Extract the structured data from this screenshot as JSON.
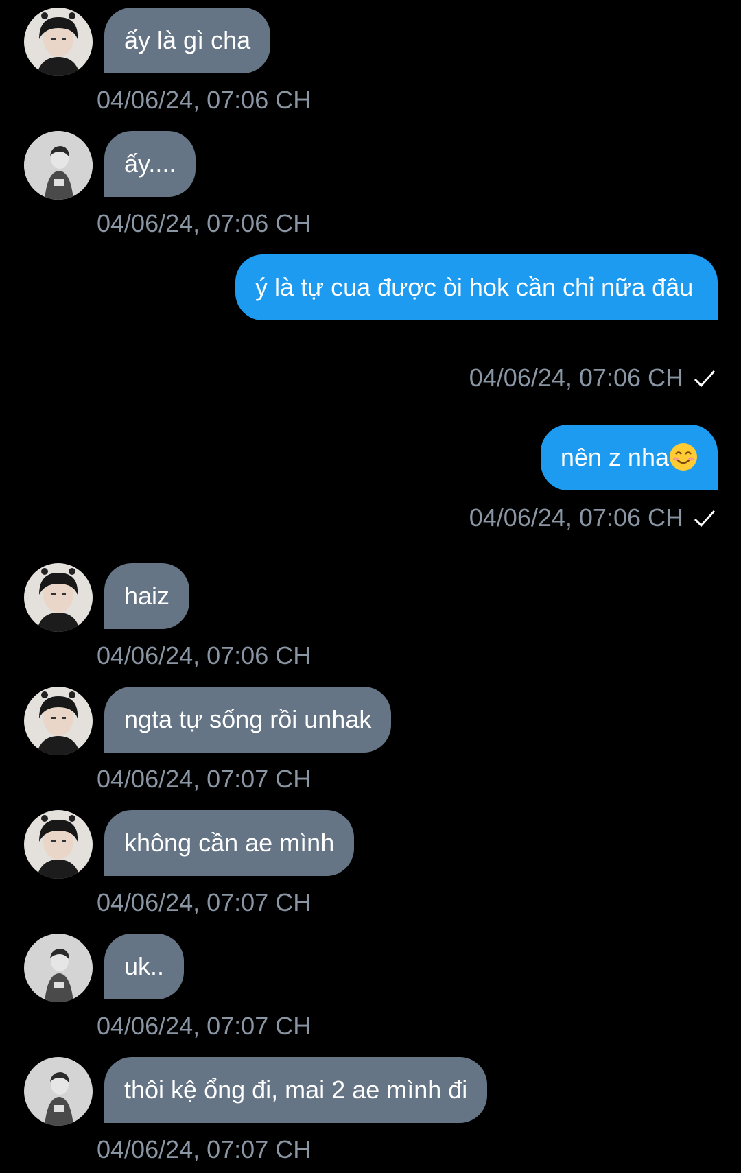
{
  "messages": [
    {
      "side": "in",
      "avatar": "avatar-a",
      "text": "ấy là gì cha",
      "time": "04/06/24, 07:06 CH"
    },
    {
      "side": "in",
      "avatar": "avatar-b",
      "text": "ấy....",
      "time": "04/06/24, 07:06 CH"
    },
    {
      "side": "out",
      "text": "ý là tự cua được òi hok cần chỉ nữa đâu",
      "time": "04/06/24, 07:06 CH",
      "status_icon": "check-icon"
    },
    {
      "side": "out",
      "text": "nên z nha",
      "emoji": "smiling-face-icon",
      "time": "04/06/24, 07:06 CH",
      "status_icon": "check-icon"
    },
    {
      "side": "in",
      "avatar": "avatar-a",
      "text": "haiz",
      "time": "04/06/24, 07:06 CH"
    },
    {
      "side": "in",
      "avatar": "avatar-a",
      "text": "ngta tự sống rồi unhak",
      "time": "04/06/24, 07:07 CH"
    },
    {
      "side": "in",
      "avatar": "avatar-a",
      "text": "không cần ae mình",
      "time": "04/06/24, 07:07 CH"
    },
    {
      "side": "in",
      "avatar": "avatar-b",
      "text": "uk..",
      "time": "04/06/24, 07:07 CH"
    },
    {
      "side": "in",
      "avatar": "avatar-b",
      "text": "thôi kệ ổng đi, mai 2 ae mình đi",
      "time": "04/06/24, 07:07 CH"
    }
  ],
  "colors": {
    "background": "#000000",
    "incoming_bubble": "#657586",
    "outgoing_bubble": "#1d9bf0",
    "timestamp": "#8a96a3",
    "text": "#ffffff"
  }
}
